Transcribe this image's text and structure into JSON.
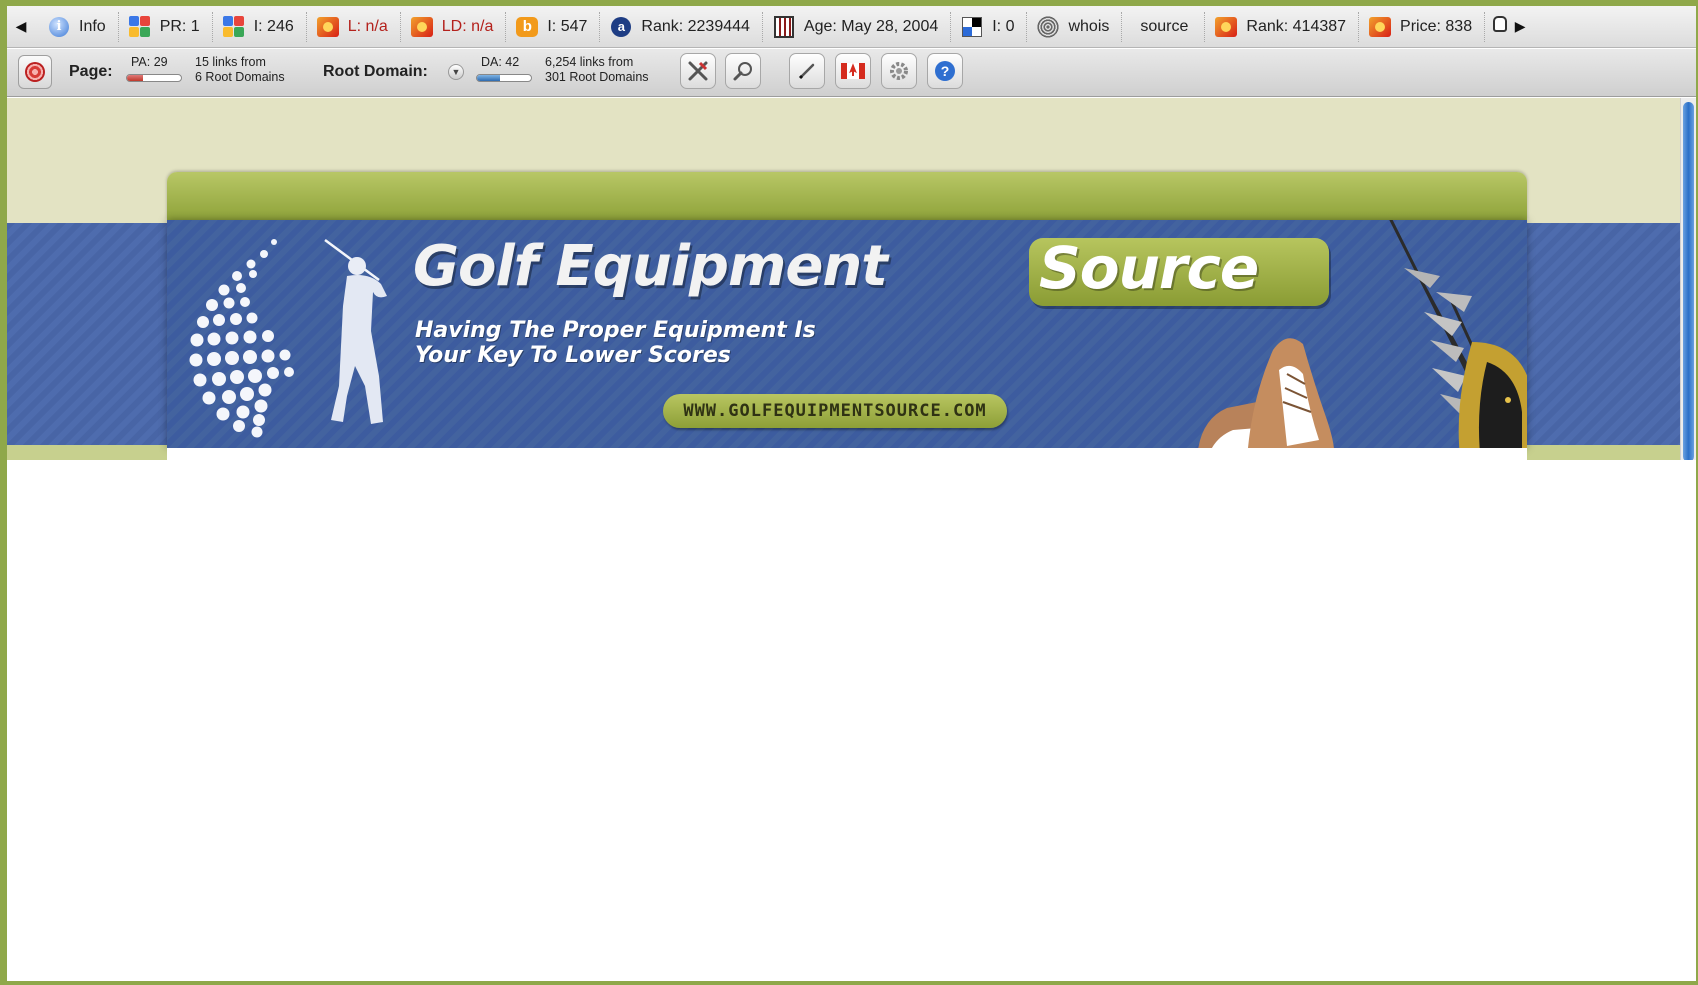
{
  "toolbar1": {
    "items": [
      {
        "icon": "info-icon",
        "label": "Info",
        "alert": false
      },
      {
        "icon": "google-icon",
        "label": "PR: 1",
        "alert": false
      },
      {
        "icon": "google-icon",
        "label": "I: 246",
        "alert": false
      },
      {
        "icon": "yahoo-flame-icon",
        "label": "L: n/a",
        "alert": true
      },
      {
        "icon": "yahoo-flame-icon",
        "label": "LD: n/a",
        "alert": true
      },
      {
        "icon": "bing-icon",
        "label": "I: 547",
        "alert": false
      },
      {
        "icon": "alexa-icon",
        "label": "Rank: 2239444",
        "alert": false
      },
      {
        "icon": "archive-icon",
        "label": "Age: May 28, 2004",
        "alert": false
      },
      {
        "icon": "delicious-icon",
        "label": "I: 0",
        "alert": false
      },
      {
        "icon": "whois-icon",
        "label": "whois",
        "alert": false
      },
      {
        "icon": "none",
        "label": "source",
        "alert": false
      },
      {
        "icon": "flame-icon",
        "label": "Rank: 414387",
        "alert": false
      },
      {
        "icon": "flame-icon",
        "label": "Price: 838",
        "alert": false
      }
    ]
  },
  "toolbar2": {
    "page_label": "Page:",
    "pa": "PA: 29",
    "pa_fill": 0.29,
    "page_links_line1": "15 links from",
    "page_links_line2": "6 Root Domains",
    "root_domain_label": "Root Domain:",
    "da": "DA: 42",
    "da_fill": 0.42,
    "root_links_line1": "6,254 links from",
    "root_links_line2": "301 Root Domains",
    "buttons": [
      "tools-icon",
      "search-icon",
      "highlight-pen-icon",
      "canada-flag-icon",
      "settings-gear-icon",
      "help-icon"
    ]
  },
  "site": {
    "title_main": "Golf Equipment",
    "title_accent": "Source",
    "tagline_line1": "Having The Proper Equipment Is",
    "tagline_line2": "Your Key To Lower Scores",
    "url": "WWW.GOLFEQUIPMENTSOURCE.COM"
  },
  "colors": {
    "frame_green": "#8fa84a",
    "band_blue": "#4865a6",
    "accent_green": "#a3b44d",
    "page_bg": "#e3e3c3"
  }
}
